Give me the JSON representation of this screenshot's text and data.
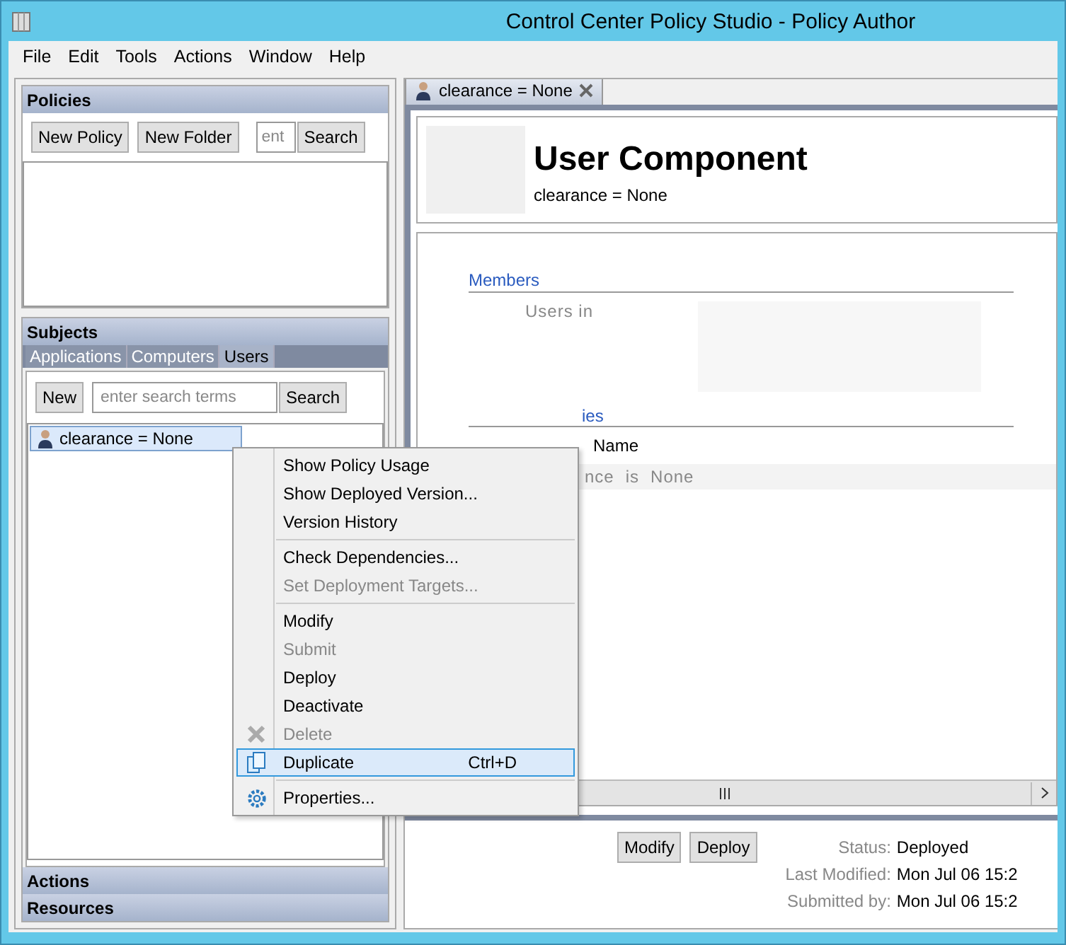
{
  "window": {
    "title": "Control Center Policy Studio - Policy Author"
  },
  "menu_bar": [
    "File",
    "Edit",
    "Tools",
    "Actions",
    "Window",
    "Help"
  ],
  "policies": {
    "title": "Policies",
    "buttons": [
      "New Policy",
      "New Folder"
    ],
    "search": {
      "placeholder": "ent",
      "button": "Search"
    }
  },
  "subjects": {
    "title": "Subjects",
    "tabs": [
      {
        "label": "Applications",
        "selected": false
      },
      {
        "label": "Computers",
        "selected": false
      },
      {
        "label": "Users",
        "selected": true
      }
    ],
    "new_button": "New",
    "search": {
      "placeholder": "enter search terms",
      "button": "Search"
    },
    "items": [
      {
        "label": "clearance = None",
        "selected": true
      }
    ]
  },
  "collapsed_sections": [
    "Actions",
    "Resources"
  ],
  "editor_tab": {
    "label": "clearance = None"
  },
  "component": {
    "title": "User Component",
    "subtitle": "clearance = None",
    "members_heading": "Members",
    "members_label": "Users in",
    "properties_heading": "ies",
    "property_column": "Name",
    "property_row": [
      "nce",
      "is",
      "None"
    ]
  },
  "footer": {
    "buttons": [
      "Modify",
      "Deploy"
    ],
    "info": [
      {
        "label": "Status:",
        "value": "Deployed"
      },
      {
        "label": "Last Modified:",
        "value": "Mon Jul 06 15:2"
      },
      {
        "label": "Submitted by:",
        "value": "Mon Jul 06 15:2"
      }
    ]
  },
  "context_menu": {
    "groups": [
      [
        {
          "kind": "plain",
          "label": "Show Policy Usage",
          "disabled": false,
          "selected": false
        },
        {
          "kind": "plain",
          "label": "Show Deployed Version...",
          "disabled": false,
          "selected": false
        },
        {
          "kind": "plain",
          "label": "Version History",
          "disabled": false,
          "selected": false
        }
      ],
      [
        {
          "kind": "plain",
          "label": "Check Dependencies...",
          "disabled": false,
          "selected": false
        },
        {
          "kind": "plain",
          "label": "Set Deployment Targets...",
          "disabled": true,
          "selected": false
        }
      ],
      [
        {
          "kind": "plain",
          "label": "Modify",
          "disabled": false,
          "selected": false
        },
        {
          "kind": "plain",
          "label": "Submit",
          "disabled": true,
          "selected": false
        },
        {
          "kind": "plain",
          "label": "Deploy",
          "disabled": false,
          "selected": false
        },
        {
          "kind": "plain",
          "label": "Deactivate",
          "disabled": false,
          "selected": false
        },
        {
          "kind": "delete",
          "label": "Delete",
          "disabled": true,
          "selected": false
        },
        {
          "kind": "duplicate",
          "label": "Duplicate",
          "disabled": false,
          "selected": true,
          "shortcut": "Ctrl+D"
        }
      ],
      [
        {
          "kind": "properties",
          "label": "Properties...",
          "disabled": false,
          "selected": false
        }
      ]
    ]
  }
}
